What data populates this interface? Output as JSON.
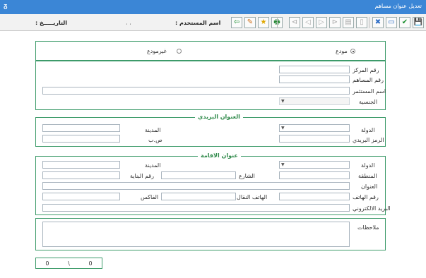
{
  "window": {
    "title": "تعديل عنوان مساهم",
    "system_icon": "app-icon"
  },
  "toolbar": {
    "user_label": "اسم المستخدم :",
    "user_value": "، ،",
    "date_label": "التاريـــــخ :",
    "buttons": [
      {
        "name": "save-icon",
        "glyph": "💾",
        "color": "#1a8f2f"
      },
      {
        "name": "confirm-icon",
        "glyph": "✔",
        "color": "#1a8f2f"
      },
      {
        "name": "monitor-icon",
        "glyph": "▭",
        "color": "#2a6bc6"
      },
      {
        "name": "delete-icon",
        "glyph": "✖",
        "color": "#2a6bc6"
      },
      {
        "name": "new-document-icon",
        "glyph": "▯",
        "color": "#aaaaaa"
      },
      {
        "name": "folder-icon",
        "glyph": "▤",
        "color": "#aaaaaa"
      },
      {
        "name": "last-record-icon",
        "glyph": "⊳",
        "color": "#aaaaaa"
      },
      {
        "name": "next-record-icon",
        "glyph": "▷",
        "color": "#aaaaaa"
      },
      {
        "name": "previous-record-icon",
        "glyph": "◁",
        "color": "#aaaaaa"
      },
      {
        "name": "first-record-icon",
        "glyph": "⊲",
        "color": "#aaaaaa"
      },
      {
        "name": "print-icon",
        "glyph": "🖶",
        "color": "#2a8a3a"
      },
      {
        "name": "favorite-icon",
        "glyph": "★",
        "color": "#e0a800"
      },
      {
        "name": "notes-icon",
        "glyph": "✎",
        "color": "#d07018"
      },
      {
        "name": "exit-icon",
        "glyph": "⇦",
        "color": "#1a8f2f"
      }
    ]
  },
  "depositor": {
    "option_deposited": "مودع",
    "option_not_deposited": "غيرمودع",
    "selected": "مودع"
  },
  "main": {
    "center_no_label": "رقم المركز",
    "shareholder_no_label": "رقم المساهم",
    "investor_name_label": "اسم المستثمر",
    "nationality_label": "الجنسية"
  },
  "postal": {
    "legend": "العنوان البريدي",
    "country_label": "الدولة",
    "city_label": "المدينة",
    "postal_code_label": "الرمز البريدي",
    "po_box_label": "ص.ب"
  },
  "residence": {
    "legend": "عنوان الاقامة",
    "country_label": "الدولة",
    "city_label": "المدينة",
    "region_label": "المنطقة",
    "street_label": "الشارع",
    "building_label": "رقم البناية",
    "address_label": "العنوان",
    "phone_label": "رقم الهاتف",
    "mobile_label": "الهاتف النقال",
    "fax_label": "الفاكس",
    "email_label": "البريد الالكتروني"
  },
  "notes": {
    "label": "ملاحظات"
  },
  "record_counter": {
    "current": "0",
    "separator": "\\",
    "total": "0"
  }
}
